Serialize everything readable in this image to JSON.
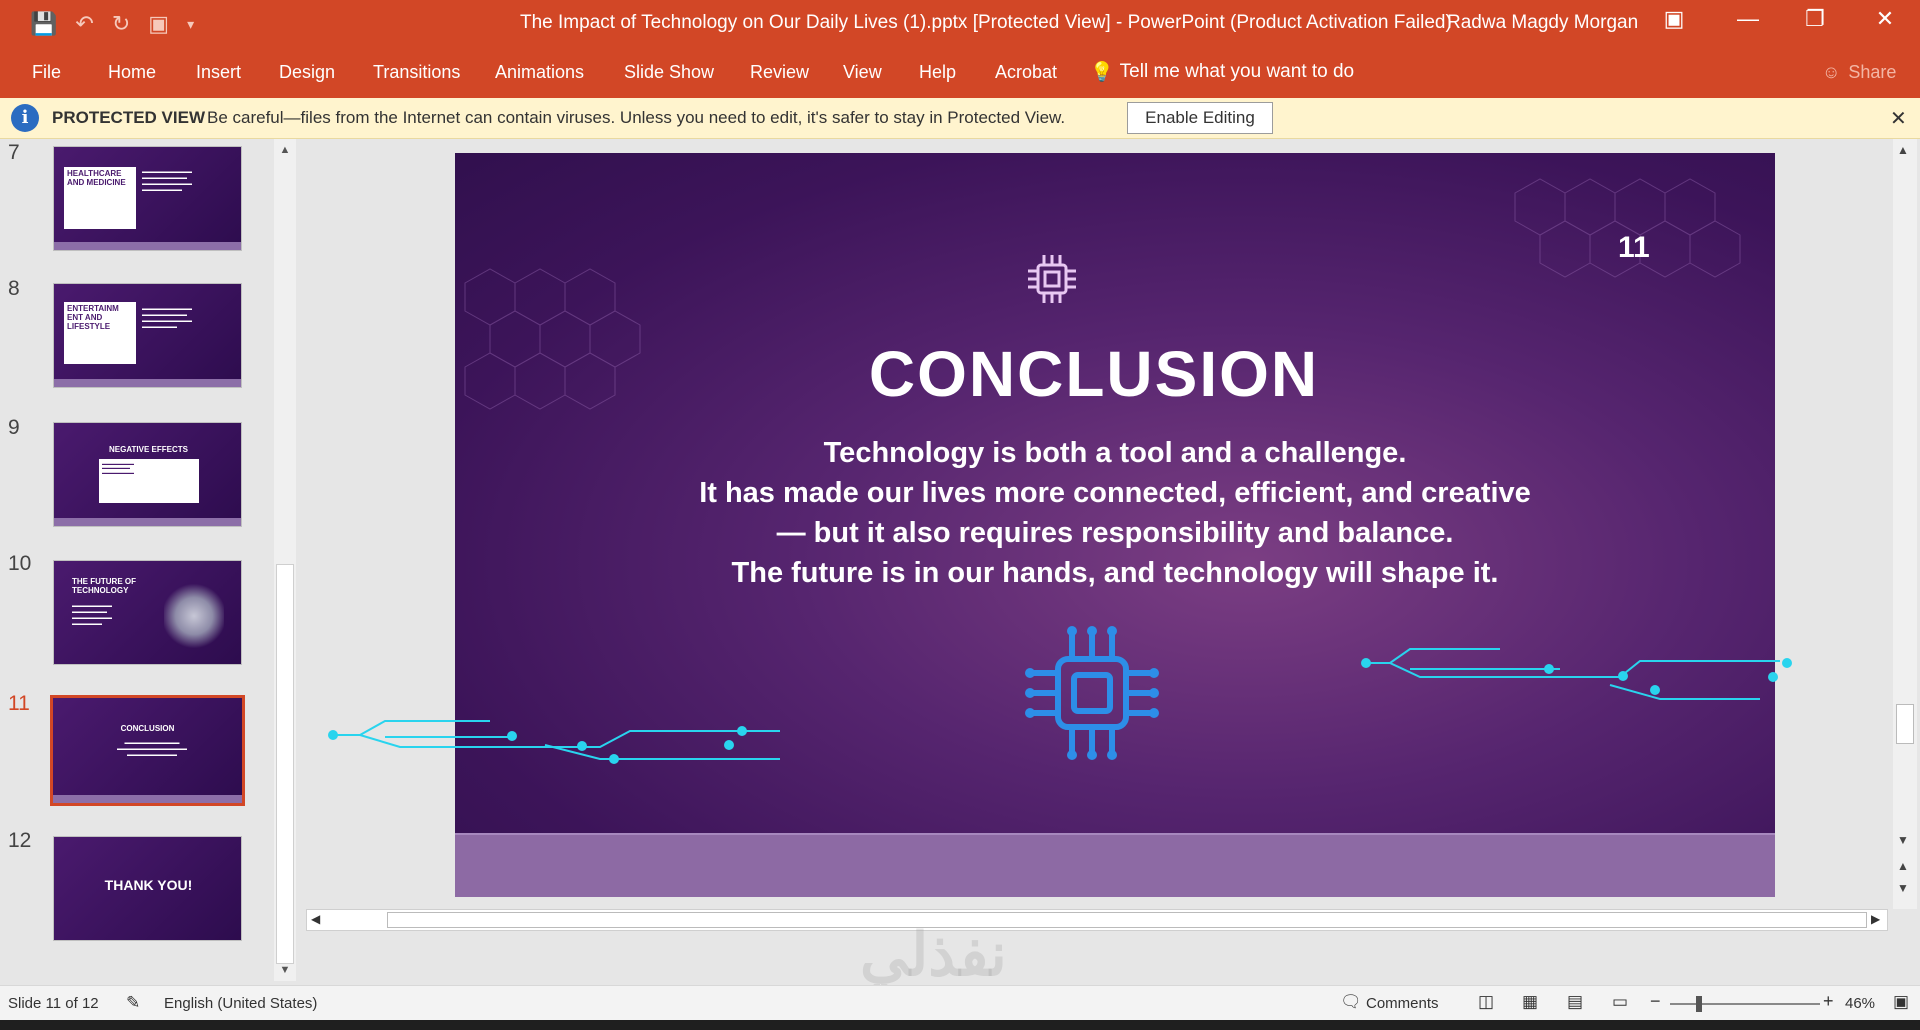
{
  "window": {
    "title": "The Impact of Technology on Our Daily Lives (1).pptx [Protected View]  -  PowerPoint (Product Activation Failed)",
    "user": "Radwa Magdy Morgan"
  },
  "ribbon": {
    "tabs": [
      "File",
      "Home",
      "Insert",
      "Design",
      "Transitions",
      "Animations",
      "Slide Show",
      "Review",
      "View",
      "Help",
      "Acrobat"
    ],
    "tell_me": "Tell me what you want to do",
    "share": "Share"
  },
  "protected_view": {
    "label": "PROTECTED VIEW",
    "message": "Be careful—files from the Internet can contain viruses. Unless you need to edit, it's safer to stay in Protected View.",
    "button": "Enable Editing"
  },
  "thumbnails": [
    {
      "number": "7",
      "title": "HEALTHCARE AND MEDICINE"
    },
    {
      "number": "8",
      "title": "ENTERTAINM ENT AND LIFESTYLE"
    },
    {
      "number": "9",
      "title": "NEGATIVE EFFECTS"
    },
    {
      "number": "10",
      "title": "THE FUTURE OF TECHNOLOGY"
    },
    {
      "number": "11",
      "title": "CONCLUSION",
      "selected": true
    },
    {
      "number": "12",
      "title": "THANK YOU!"
    }
  ],
  "slide": {
    "number": "11",
    "title": "CONCLUSION",
    "lines": [
      "Technology is both a tool and a challenge.",
      "It has made our lives more connected, efficient, and creative",
      "— but it also requires responsibility and balance.",
      "The future is in our hands, and technology will shape it."
    ]
  },
  "status": {
    "slide_info": "Slide 11 of 12",
    "language": "English (United States)",
    "comments": "Comments",
    "zoom": "46%"
  },
  "colors": {
    "accent": "#d24726",
    "circuit": "#29d4ee",
    "slide_bg": "#4a1a6e"
  }
}
